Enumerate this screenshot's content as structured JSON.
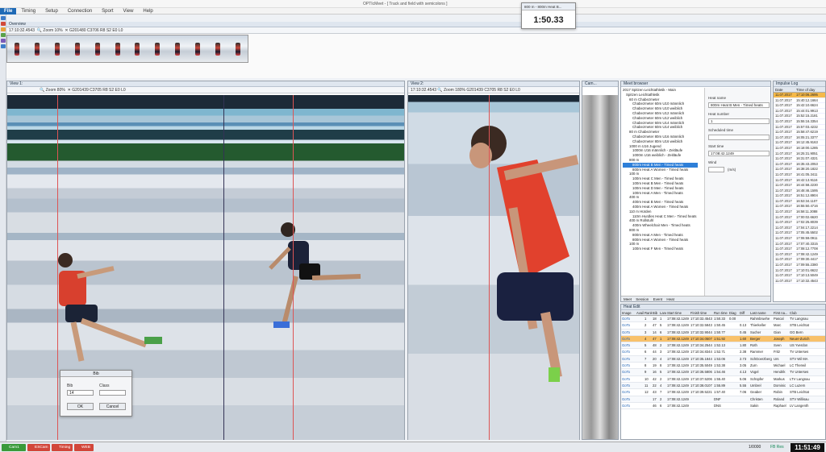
{
  "app": {
    "title": "OPTIcMeet - [ Track and field with semicolons ]"
  },
  "menu": {
    "file": "File",
    "items": [
      "Timing",
      "Setup",
      "Connection",
      "Sport",
      "View",
      "Help"
    ]
  },
  "timer": {
    "title": "800 m - 800m Heat B...",
    "value": "1:50.33"
  },
  "overview": {
    "header": "Overview",
    "toolbar": {
      "time": "17:10:32.4543",
      "zoom": "Zoom 10%",
      "camera": "G201480 C3706 R8 S2 E0 L0"
    }
  },
  "view1": {
    "header": "View 1:",
    "toolbar": {
      "zoom": "Zoom 80%",
      "camera": "G201439 C3705 R8 S2 E0 L0"
    }
  },
  "view2": {
    "header": "View 2:",
    "toolbar": {
      "time": "17:10:32.4543",
      "zoom": "Zoom 180%",
      "camera": "G201439 C3705 R8 S2 E0 L0"
    }
  },
  "viewC": {
    "header": "Cam..."
  },
  "dialog": {
    "title": "Bib",
    "bib_label": "Bib",
    "bib_value": "14",
    "class_label": "Class",
    "class_value": "",
    "ok": "OK",
    "cancel": "Cancel"
  },
  "meet": {
    "header": "Meet browser",
    "tree": [
      "2017 Spitzen Leichtathletik - Main",
      "Spitzen Leichtathletik",
      "60 m Chabezmeter",
      "Chabezmeter 60m U10 männlich",
      "Chabezmeter 60m U10 weiblich",
      "Chabezmeter 60m U12 männlich",
      "Chabezmeter 60m U12 weiblich",
      "Chabezmeter 60m U14 männlich",
      "Chabezmeter 60m U14 weiblich",
      "80 m Chabezmeter",
      "Chabezmeter 80m U16 männlich",
      "Chabezmeter 80m U16 weiblich",
      "1000 m U16 Jugend",
      "1000m U16 männlich - Zeitläufe",
      "1000m U16 weiblich - Zeitläufe",
      "800 m",
      "800m Heat B Men - Timed heats",
      "800m Heat A Women - Timed heats",
      "100 m",
      "100m Heat C Men - Timed heats",
      "100m Heat B Men - Timed heats",
      "100m Heat D Men - Timed heats",
      "100m Heat A Men - Timed heats",
      "400 m",
      "400m Heat B Men - Timed heats",
      "400m Heat A Women - Timed heats",
      "110 m Hürden",
      "110m Hurdles Heat C Men - Timed heats",
      "400 m Rollstuhl",
      "400m Wheelchair Men - Timed heats",
      "800 m",
      "800m Heat A Men - Timed heats",
      "800m Heat A Women - Timed heats",
      "100 m",
      "100m Heat F Men - Timed heats"
    ],
    "selected_index": 16,
    "form": {
      "heat_name_label": "Heat name",
      "heat_name": "800m Heat B Men - Timed heats",
      "heat_number_label": "Heat number",
      "heat_number": "1",
      "scheduled_label": "Scheduled time",
      "scheduled": "",
      "start_label": "Start time",
      "start": "17:08:42.1249",
      "wind_label": "Wind",
      "wind_unit": "(m/s)"
    },
    "tabs": [
      "Meet",
      "Session",
      "Event",
      "Heat"
    ]
  },
  "log": {
    "header": "Impulse Log",
    "columns": [
      "Date",
      "Time of day"
    ],
    "rows": [
      [
        "11.07.2017",
        "17:10:06.2695"
      ],
      [
        "11.07.2017",
        "15:40:12.1664"
      ],
      [
        "11.07.2017",
        "15:42:10.6624"
      ],
      [
        "11.07.2017",
        "15:44:01.9913"
      ],
      [
        "11.07.2017",
        "15:52:15.2181"
      ],
      [
        "11.07.2017",
        "15:55:16.3354"
      ],
      [
        "11.07.2017",
        "15:57:03.4232"
      ],
      [
        "11.07.2017",
        "15:58:47.6219"
      ],
      [
        "11.07.2017",
        "16:05:21.3377"
      ],
      [
        "11.07.2017",
        "16:12:45.9163"
      ],
      [
        "11.07.2017",
        "16:18:00.1285"
      ],
      [
        "11.07.2017",
        "16:25:31.9051"
      ],
      [
        "11.07.2017",
        "16:31:07.4321"
      ],
      [
        "11.07.2017",
        "16:35:43.2053"
      ],
      [
        "11.07.2017",
        "16:38:20.1822"
      ],
      [
        "11.07.2017",
        "16:41:05.3411"
      ],
      [
        "11.07.2017",
        "16:42:13.9116"
      ],
      [
        "11.07.2017",
        "16:44:58.2230"
      ],
      [
        "11.07.2017",
        "16:48:46.1595"
      ],
      [
        "11.07.2017",
        "16:51:12.8904"
      ],
      [
        "11.07.2017",
        "16:53:34.1107"
      ],
      [
        "11.07.2017",
        "16:55:50.4716"
      ],
      [
        "11.07.2017",
        "16:58:11.3088"
      ],
      [
        "11.07.2017",
        "17:00:02.6620"
      ],
      [
        "11.07.2017",
        "17:02:25.8039"
      ],
      [
        "11.07.2017",
        "17:04:17.2214"
      ],
      [
        "11.07.2017",
        "17:05:45.5502"
      ],
      [
        "11.07.2017",
        "17:06:59.0911"
      ],
      [
        "11.07.2017",
        "17:07:40.3315"
      ],
      [
        "11.07.2017",
        "17:08:12.7708"
      ],
      [
        "11.07.2017",
        "17:08:42.1249"
      ],
      [
        "11.07.2017",
        "17:09:30.4417"
      ],
      [
        "11.07.2017",
        "17:09:55.2380"
      ],
      [
        "11.07.2017",
        "17:10:01.6622"
      ],
      [
        "11.07.2017",
        "17:10:13.5049"
      ],
      [
        "11.07.2017",
        "17:10:32.4543"
      ]
    ]
  },
  "heat": {
    "header": "Heat Edit",
    "columns": [
      "Image",
      "Avail",
      "Rank",
      "Bib",
      "Lane",
      "Start time",
      "Finish time",
      "Run time",
      "Diag",
      "Diff",
      "Last name",
      "First na...",
      "Club"
    ],
    "rows": [
      [
        "GoTo",
        "",
        "1",
        "18",
        "1",
        "17:08:42.1249",
        "17:10:32.4543",
        "1:50.33",
        "0.00",
        "",
        "Rahmbruehe",
        "Pascal",
        "TV Langnau"
      ],
      [
        "GoTo",
        "",
        "2",
        "47",
        "5",
        "17:08:42.1249",
        "17:10:32.5843",
        "1:50.45",
        "",
        "0.13",
        "Thierkeller",
        "Marc",
        "STB Leichtat"
      ],
      [
        "GoTo",
        "",
        "3",
        "14",
        "6",
        "17:08:42.1249",
        "17:10:32.9044",
        "1:50.77",
        "",
        "0.45",
        "Sucher",
        "Gian",
        "GG Bern"
      ],
      [
        "GoTo",
        "",
        "4",
        "47",
        "1",
        "17:08:42.1249",
        "17:10:34.0507",
        "1:51.92",
        "",
        "1.60",
        "Berger",
        "Joseph",
        "Neuer-Zurich"
      ],
      [
        "GoTo",
        "",
        "5",
        "48",
        "2",
        "17:08:42.1249",
        "17:10:34.2544",
        "1:52.13",
        "",
        "1.80",
        "Roth",
        "Sven",
        "US Yverdon"
      ],
      [
        "GoTo",
        "",
        "6",
        "44",
        "3",
        "17:08:42.1249",
        "17:10:34.8344",
        "1:52.71",
        "",
        "2.38",
        "Rammer",
        "Fritz",
        "TV Unterses"
      ],
      [
        "GoTo",
        "",
        "7",
        "20",
        "4",
        "17:08:42.1249",
        "17:10:35.1844",
        "1:53.06",
        "",
        "2.73",
        "SchDoerzberg",
        "Urs",
        "STV Wil MA"
      ],
      [
        "GoTo",
        "",
        "8",
        "19",
        "8",
        "17:08:42.1249",
        "17:10:35.5049",
        "1:53.38",
        "",
        "3.05",
        "Zurn",
        "Michael",
        "LC Therwil"
      ],
      [
        "GoTo",
        "",
        "9",
        "16",
        "5",
        "17:08:42.1249",
        "17:10:36.5806",
        "1:54.46",
        "",
        "4.13",
        "Vogel",
        "Hendrik",
        "TV Unterses"
      ],
      [
        "GoTo",
        "",
        "10",
        "42",
        "2",
        "17:08:42.1249",
        "17:10:37.5206",
        "1:55.40",
        "",
        "5.06",
        "Schüpfer",
        "Markus",
        "LTV Langnau"
      ],
      [
        "GoTo",
        "",
        "11",
        "22",
        "4",
        "17:08:42.1249",
        "17:10:38.0107",
        "1:55.89",
        "",
        "5.55",
        "Umbrel",
        "Dominic",
        "LC Luzern"
      ],
      [
        "GoTo",
        "",
        "12",
        "43",
        "7",
        "17:08:42.1249",
        "17:10:39.5221",
        "1:57.40",
        "",
        "7.06",
        "Geaber",
        "Robin",
        "STB Leichtat"
      ],
      [
        "GoTo",
        "",
        "",
        "17",
        "2",
        "17:08:42.1249",
        "",
        "DNF",
        "",
        "",
        "Christen",
        "Roland",
        "STV Willisau"
      ],
      [
        "GoTo",
        "",
        "",
        "46",
        "6",
        "17:08:42.1249",
        "",
        "DNS",
        "",
        "",
        "Sakin",
        "Raphael",
        "LV Langenth"
      ]
    ],
    "selected_index": 3
  },
  "status": {
    "buttons": [
      "Cam1",
      "ESCam",
      "Timing",
      "WEB"
    ],
    "page": "1/0000",
    "net": "FB Res",
    "clock": "11:51:49"
  }
}
